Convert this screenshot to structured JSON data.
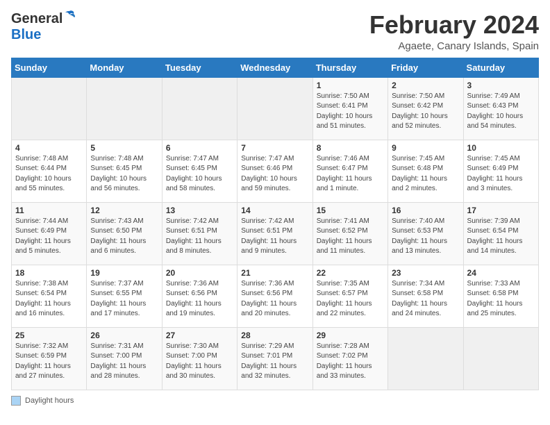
{
  "header": {
    "logo_general": "General",
    "logo_blue": "Blue",
    "month_year": "February 2024",
    "location": "Agaete, Canary Islands, Spain"
  },
  "days_of_week": [
    "Sunday",
    "Monday",
    "Tuesday",
    "Wednesday",
    "Thursday",
    "Friday",
    "Saturday"
  ],
  "weeks": [
    [
      {
        "day": "",
        "sunrise": "",
        "sunset": "",
        "daylight": "",
        "empty": true
      },
      {
        "day": "",
        "sunrise": "",
        "sunset": "",
        "daylight": "",
        "empty": true
      },
      {
        "day": "",
        "sunrise": "",
        "sunset": "",
        "daylight": "",
        "empty": true
      },
      {
        "day": "",
        "sunrise": "",
        "sunset": "",
        "daylight": "",
        "empty": true
      },
      {
        "day": "1",
        "sunrise": "Sunrise: 7:50 AM",
        "sunset": "Sunset: 6:41 PM",
        "daylight": "Daylight: 10 hours and 51 minutes.",
        "empty": false
      },
      {
        "day": "2",
        "sunrise": "Sunrise: 7:50 AM",
        "sunset": "Sunset: 6:42 PM",
        "daylight": "Daylight: 10 hours and 52 minutes.",
        "empty": false
      },
      {
        "day": "3",
        "sunrise": "Sunrise: 7:49 AM",
        "sunset": "Sunset: 6:43 PM",
        "daylight": "Daylight: 10 hours and 54 minutes.",
        "empty": false
      }
    ],
    [
      {
        "day": "4",
        "sunrise": "Sunrise: 7:48 AM",
        "sunset": "Sunset: 6:44 PM",
        "daylight": "Daylight: 10 hours and 55 minutes.",
        "empty": false
      },
      {
        "day": "5",
        "sunrise": "Sunrise: 7:48 AM",
        "sunset": "Sunset: 6:45 PM",
        "daylight": "Daylight: 10 hours and 56 minutes.",
        "empty": false
      },
      {
        "day": "6",
        "sunrise": "Sunrise: 7:47 AM",
        "sunset": "Sunset: 6:45 PM",
        "daylight": "Daylight: 10 hours and 58 minutes.",
        "empty": false
      },
      {
        "day": "7",
        "sunrise": "Sunrise: 7:47 AM",
        "sunset": "Sunset: 6:46 PM",
        "daylight": "Daylight: 10 hours and 59 minutes.",
        "empty": false
      },
      {
        "day": "8",
        "sunrise": "Sunrise: 7:46 AM",
        "sunset": "Sunset: 6:47 PM",
        "daylight": "Daylight: 11 hours and 1 minute.",
        "empty": false
      },
      {
        "day": "9",
        "sunrise": "Sunrise: 7:45 AM",
        "sunset": "Sunset: 6:48 PM",
        "daylight": "Daylight: 11 hours and 2 minutes.",
        "empty": false
      },
      {
        "day": "10",
        "sunrise": "Sunrise: 7:45 AM",
        "sunset": "Sunset: 6:49 PM",
        "daylight": "Daylight: 11 hours and 3 minutes.",
        "empty": false
      }
    ],
    [
      {
        "day": "11",
        "sunrise": "Sunrise: 7:44 AM",
        "sunset": "Sunset: 6:49 PM",
        "daylight": "Daylight: 11 hours and 5 minutes.",
        "empty": false
      },
      {
        "day": "12",
        "sunrise": "Sunrise: 7:43 AM",
        "sunset": "Sunset: 6:50 PM",
        "daylight": "Daylight: 11 hours and 6 minutes.",
        "empty": false
      },
      {
        "day": "13",
        "sunrise": "Sunrise: 7:42 AM",
        "sunset": "Sunset: 6:51 PM",
        "daylight": "Daylight: 11 hours and 8 minutes.",
        "empty": false
      },
      {
        "day": "14",
        "sunrise": "Sunrise: 7:42 AM",
        "sunset": "Sunset: 6:51 PM",
        "daylight": "Daylight: 11 hours and 9 minutes.",
        "empty": false
      },
      {
        "day": "15",
        "sunrise": "Sunrise: 7:41 AM",
        "sunset": "Sunset: 6:52 PM",
        "daylight": "Daylight: 11 hours and 11 minutes.",
        "empty": false
      },
      {
        "day": "16",
        "sunrise": "Sunrise: 7:40 AM",
        "sunset": "Sunset: 6:53 PM",
        "daylight": "Daylight: 11 hours and 13 minutes.",
        "empty": false
      },
      {
        "day": "17",
        "sunrise": "Sunrise: 7:39 AM",
        "sunset": "Sunset: 6:54 PM",
        "daylight": "Daylight: 11 hours and 14 minutes.",
        "empty": false
      }
    ],
    [
      {
        "day": "18",
        "sunrise": "Sunrise: 7:38 AM",
        "sunset": "Sunset: 6:54 PM",
        "daylight": "Daylight: 11 hours and 16 minutes.",
        "empty": false
      },
      {
        "day": "19",
        "sunrise": "Sunrise: 7:37 AM",
        "sunset": "Sunset: 6:55 PM",
        "daylight": "Daylight: 11 hours and 17 minutes.",
        "empty": false
      },
      {
        "day": "20",
        "sunrise": "Sunrise: 7:36 AM",
        "sunset": "Sunset: 6:56 PM",
        "daylight": "Daylight: 11 hours and 19 minutes.",
        "empty": false
      },
      {
        "day": "21",
        "sunrise": "Sunrise: 7:36 AM",
        "sunset": "Sunset: 6:56 PM",
        "daylight": "Daylight: 11 hours and 20 minutes.",
        "empty": false
      },
      {
        "day": "22",
        "sunrise": "Sunrise: 7:35 AM",
        "sunset": "Sunset: 6:57 PM",
        "daylight": "Daylight: 11 hours and 22 minutes.",
        "empty": false
      },
      {
        "day": "23",
        "sunrise": "Sunrise: 7:34 AM",
        "sunset": "Sunset: 6:58 PM",
        "daylight": "Daylight: 11 hours and 24 minutes.",
        "empty": false
      },
      {
        "day": "24",
        "sunrise": "Sunrise: 7:33 AM",
        "sunset": "Sunset: 6:58 PM",
        "daylight": "Daylight: 11 hours and 25 minutes.",
        "empty": false
      }
    ],
    [
      {
        "day": "25",
        "sunrise": "Sunrise: 7:32 AM",
        "sunset": "Sunset: 6:59 PM",
        "daylight": "Daylight: 11 hours and 27 minutes.",
        "empty": false
      },
      {
        "day": "26",
        "sunrise": "Sunrise: 7:31 AM",
        "sunset": "Sunset: 7:00 PM",
        "daylight": "Daylight: 11 hours and 28 minutes.",
        "empty": false
      },
      {
        "day": "27",
        "sunrise": "Sunrise: 7:30 AM",
        "sunset": "Sunset: 7:00 PM",
        "daylight": "Daylight: 11 hours and 30 minutes.",
        "empty": false
      },
      {
        "day": "28",
        "sunrise": "Sunrise: 7:29 AM",
        "sunset": "Sunset: 7:01 PM",
        "daylight": "Daylight: 11 hours and 32 minutes.",
        "empty": false
      },
      {
        "day": "29",
        "sunrise": "Sunrise: 7:28 AM",
        "sunset": "Sunset: 7:02 PM",
        "daylight": "Daylight: 11 hours and 33 minutes.",
        "empty": false
      },
      {
        "day": "",
        "sunrise": "",
        "sunset": "",
        "daylight": "",
        "empty": true
      },
      {
        "day": "",
        "sunrise": "",
        "sunset": "",
        "daylight": "",
        "empty": true
      }
    ]
  ],
  "footer": {
    "swatch_label": "Daylight hours"
  }
}
